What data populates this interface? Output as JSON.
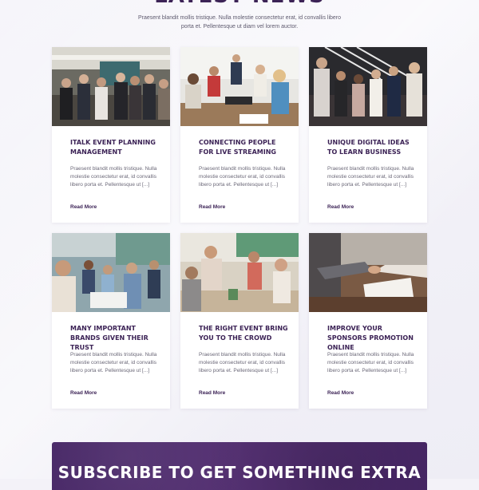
{
  "section": {
    "title": "LATEST NEWS",
    "intro": "Praesent blandit mollis tristique. Nulla molestie consectetur erat, id convallis libero porta et. Pellentesque ut diam vel lorem auctor."
  },
  "posts": [
    {
      "title": "ITALK EVENT PLANNING MANAGEMENT",
      "excerpt": "Praesent blandit mollis tristique. Nulla molestie consectetur erat, id convallis libero porta et. Pellentesque ut [...]",
      "link": "Read More"
    },
    {
      "title": "CONNECTING PEOPLE FOR LIVE STREAMING",
      "excerpt": "Praesent blandit mollis tristique. Nulla molestie consectetur erat, id convallis libero porta et. Pellentesque ut [...]",
      "link": "Read More"
    },
    {
      "title": "UNIQUE DIGITAL IDEAS TO LEARN BUSINESS",
      "excerpt": "Praesent blandit mollis tristique. Nulla molestie consectetur erat, id convallis libero porta et. Pellentesque ut [...]",
      "link": "Read More"
    },
    {
      "title": "MANY IMPORTANT BRANDS GIVEN THEIR TRUST",
      "excerpt": "Praesent blandit mollis tristique. Nulla molestie consectetur erat, id convallis libero porta et. Pellentesque ut [...]",
      "link": "Read More"
    },
    {
      "title": "THE RIGHT EVENT BRING YOU TO THE CROWD",
      "excerpt": "Praesent blandit mollis tristique. Nulla molestie consectetur erat, id convallis libero porta et. Pellentesque ut [...]",
      "link": "Read More"
    },
    {
      "title": "IMPROVE YOUR SPONSORS PROMOTION ONLINE",
      "excerpt": "Praesent blandit mollis tristique. Nulla molestie consectetur erat, id convallis libero porta et. Pellentesque ut [...]",
      "link": "Read More"
    }
  ],
  "subscribe": {
    "title": "SUBSCRIBE TO GET SOMETHING EXTRA"
  },
  "colors": {
    "brand": "#3c2356",
    "background": "#f3f2f8",
    "subscribe_bg": "#4a2a66"
  }
}
